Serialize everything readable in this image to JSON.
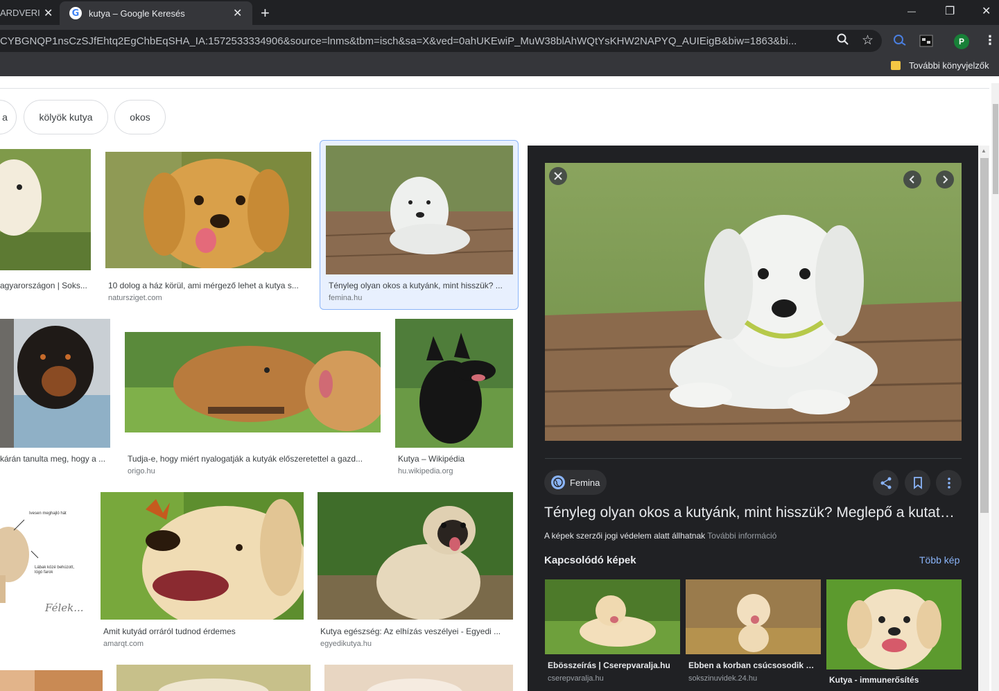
{
  "browser": {
    "inactive_tab_title": "ARDVERI",
    "active_tab_title": "kutya – Google Keresés",
    "tab_close": "✕",
    "new_tab": "+",
    "favicon_letter": "G",
    "url": "CYBGNQP1nsCzSJfEhtq2EgChbEqSHA_IA:1572533334906&source=lnms&tbm=isch&sa=X&ved=0ahUKEwiP_MuW38blAhWQtYsKHW2NAPYQ_AUIEigB&biw=1863&bi...",
    "profile_initial": "P",
    "bookmarks_label": "További könyvjelzők",
    "window_controls": {
      "minimize": "—",
      "restore": "❐",
      "close": "✕"
    }
  },
  "chips": [
    "a",
    "kölyök kutya",
    "okos"
  ],
  "results": [
    {
      "title": "agyarországon | Soks...",
      "source": ""
    },
    {
      "title": "10 dolog a ház körül, ami mérgező lehet a kutya s...",
      "source": "natursziget.com"
    },
    {
      "title": "Tényleg olyan okos a kutyánk, mint hisszük? ...",
      "source": "femina.hu"
    },
    {
      "title": "kárán tanulta meg, hogy a ...",
      "source": ""
    },
    {
      "title": "Tudja-e, hogy miért nyalogatják a kutyák előszeretettel a gazd...",
      "source": "origo.hu"
    },
    {
      "title": "Kutya – Wikipédia",
      "source": "hu.wikipedia.org"
    },
    {
      "title": "Amit kutyád orráról tudnod érdemes",
      "source": "amarqt.com"
    },
    {
      "title": "Kutya egészség: Az elhízás veszélyei - Egyedi ...",
      "source": "egyedikutya.hu"
    }
  ],
  "diagram_text": {
    "line1": "Ivesen meghajló hát",
    "line2": "Lábak közé behúzott,",
    "line3": "lógó farok",
    "signature": "Félek..."
  },
  "panel": {
    "site": "Femina",
    "title": "Tényleg olyan okos a kutyánk, mint hisszük? Meglepő a kutatók ...",
    "copyright": "A képek szerzői jogi védelem alatt állhatnak",
    "more_info": "További információ",
    "related_heading": "Kapcsolódó képek",
    "more_images": "Több kép",
    "related": [
      {
        "title": "Ebösszeírás | Cserepvaralja.hu",
        "source": "cserepvaralja.hu"
      },
      {
        "title": "Ebben a korban csúcsosodik ki...",
        "source": "sokszinuvidek.24.hu"
      },
      {
        "title": "Kutya - immunerősítés",
        "source": ""
      }
    ]
  },
  "colors": {
    "panel_bg": "#202124",
    "accent": "#8ab4f8",
    "chrome_dark": "#35363a"
  }
}
